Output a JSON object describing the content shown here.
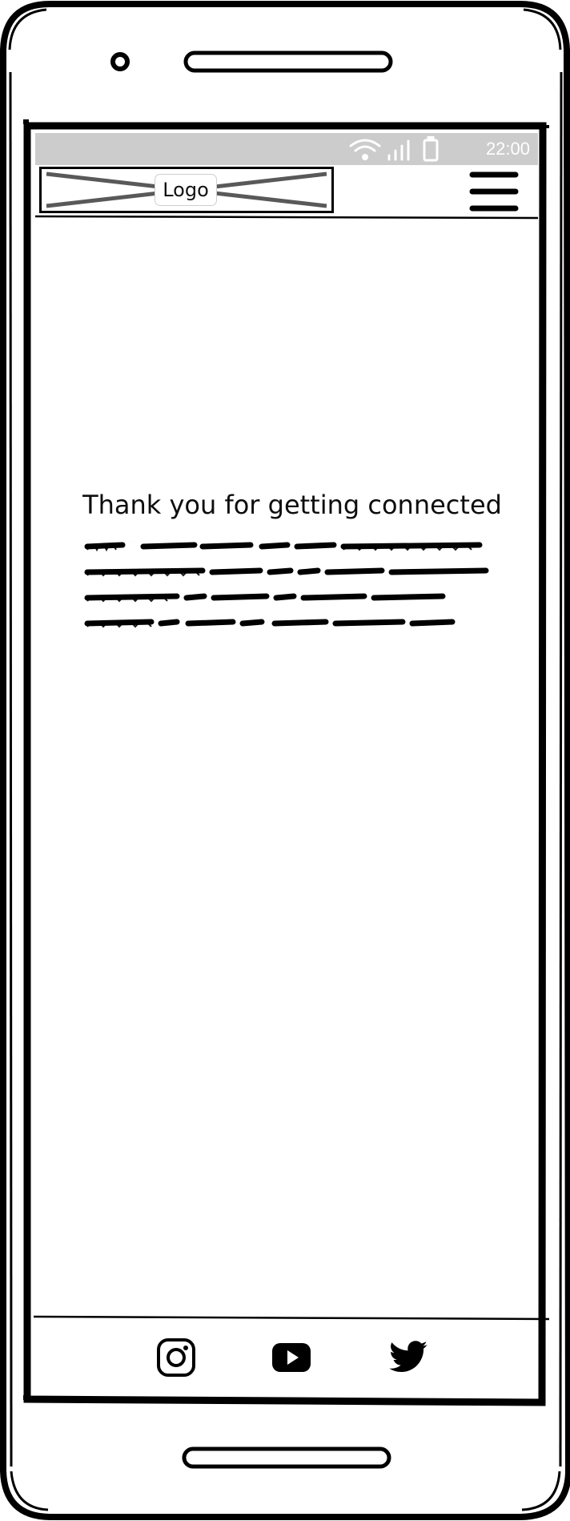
{
  "status_bar": {
    "time": "22:00",
    "icons": [
      "wifi-icon",
      "signal-icon",
      "battery-icon"
    ],
    "background": "#cccccc"
  },
  "header": {
    "logo_label": "Logo",
    "menu_icon": "hamburger-menu-icon"
  },
  "main": {
    "headline": "Thank you for getting connected",
    "body_text_placeholder": "Illegible scribbled placeholder paragraph"
  },
  "footer": {
    "social_links": [
      {
        "name": "instagram",
        "icon": "instagram-icon"
      },
      {
        "name": "youtube",
        "icon": "youtube-icon"
      },
      {
        "name": "twitter",
        "icon": "twitter-icon"
      }
    ]
  }
}
